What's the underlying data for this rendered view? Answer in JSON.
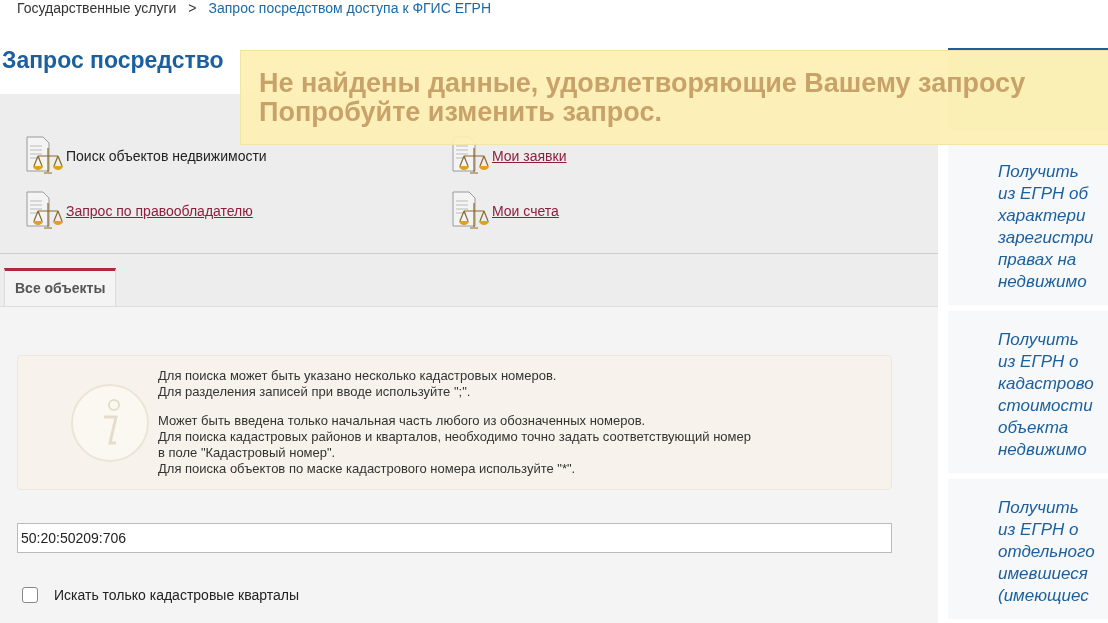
{
  "breadcrumbs": [
    {
      "label": "Государственные услуги",
      "kind": "plain"
    },
    {
      "label": ">",
      "kind": "separator"
    },
    {
      "label": "Запрос посредством доступа к ФГИС ЕГРН",
      "kind": "link"
    }
  ],
  "page_title": "Запрос посредство",
  "alert": {
    "lines": [
      "Не найдены данные, удовлетворяющие Вашему запросу",
      "Попробуйте изменить запрос."
    ]
  },
  "quick_links": [
    {
      "label": "Поиск объектов недвижимости",
      "link": false
    },
    {
      "label": "Мои заявки",
      "link": true
    },
    {
      "label": "Запрос по правообладателю",
      "link": true
    },
    {
      "label": "Мои счета",
      "link": true
    }
  ],
  "tabs": [
    {
      "label": "Все объекты",
      "selected": true
    }
  ],
  "info": {
    "paragraphs": [
      [
        "Для поиска может быть указано несколько кадастровых номеров.",
        "Для разделения записей при вводе используйте \";\"."
      ],
      [
        "Может быть введена только начальная часть любого из обозначенных номеров.",
        "Для поиска кадастровых районов и кварталов, необходимо точно задать соответствующий номер",
        "в поле \"Кадастровый номер\".",
        "Для поиска объектов по маске кадастрового номера используйте \"*\"."
      ]
    ]
  },
  "search": {
    "value": "50:20:50209:706"
  },
  "checkbox": {
    "label": "Искать только кадастровые кварталы",
    "checked": false
  },
  "side_cards": [
    {
      "lines": [
        "Получить",
        "из ЕГРН об",
        "характери",
        "зарегистри",
        "правах на",
        "недвижимо"
      ]
    },
    {
      "lines": [
        "Получить",
        "из ЕГРН о",
        "кадастрово",
        "стоимости",
        "объекта",
        "недвижимо"
      ]
    },
    {
      "lines": [
        "Получить",
        "из ЕГРН о",
        "отдельного",
        "имевшиеся",
        "(имеющиес"
      ]
    }
  ]
}
